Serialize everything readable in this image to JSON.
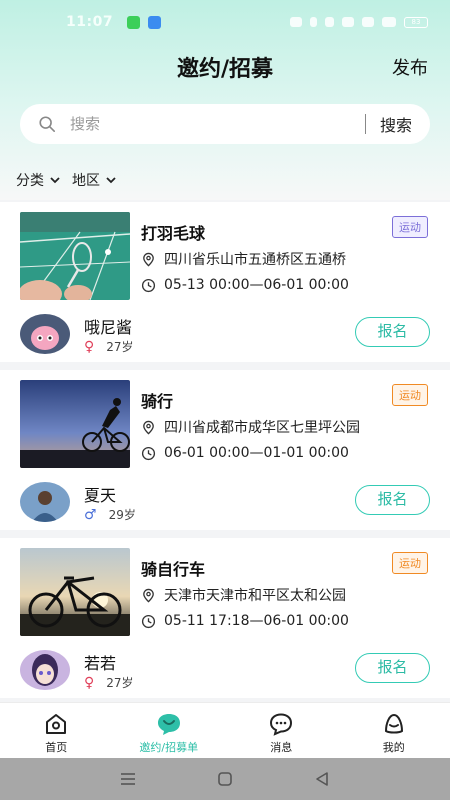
{
  "status_bar": {
    "time": "11:07",
    "battery": "83"
  },
  "header": {
    "title": "邀约/招募",
    "publish_label": "发布"
  },
  "search": {
    "placeholder": "搜索",
    "button_label": "搜索"
  },
  "filters": [
    {
      "label": "分类"
    },
    {
      "label": "地区"
    }
  ],
  "cards": [
    {
      "title": "打羽毛球",
      "tag": "运动",
      "location": "四川省乐山市五通桥区五通桥",
      "time": "05-13 00:00—06-01 00:00",
      "user": {
        "name": "哦尼酱",
        "gender": "female",
        "gender_symbol": "♀",
        "age": "27岁"
      },
      "signup_label": "报名",
      "tag_color": "#7c6fd8"
    },
    {
      "title": "骑行",
      "tag": "运动",
      "location": "四川省成都市成华区七里坪公园",
      "time": "06-01 00:00—01-01 00:00",
      "user": {
        "name": "夏天",
        "gender": "male",
        "gender_symbol": "♂",
        "age": "29岁"
      },
      "signup_label": "报名",
      "tag_color": "#f08a24"
    },
    {
      "title": "骑自行车",
      "tag": "运动",
      "location": "天津市天津市和平区太和公园",
      "time": "05-11 17:18—06-01 00:00",
      "user": {
        "name": "若若",
        "gender": "female",
        "gender_symbol": "♀",
        "age": "27岁"
      },
      "signup_label": "报名",
      "tag_color": "#f08a24"
    }
  ],
  "tabbar": [
    {
      "label": "首页",
      "icon": "home-icon",
      "active": false
    },
    {
      "label": "邀约/招募单",
      "icon": "heart-chat-icon",
      "active": true
    },
    {
      "label": "消息",
      "icon": "message-icon",
      "active": false
    },
    {
      "label": "我的",
      "icon": "profile-icon",
      "active": false
    }
  ],
  "colors": {
    "accent": "#2ebfa8",
    "female": "#e0405a",
    "male": "#4a6fd8"
  }
}
